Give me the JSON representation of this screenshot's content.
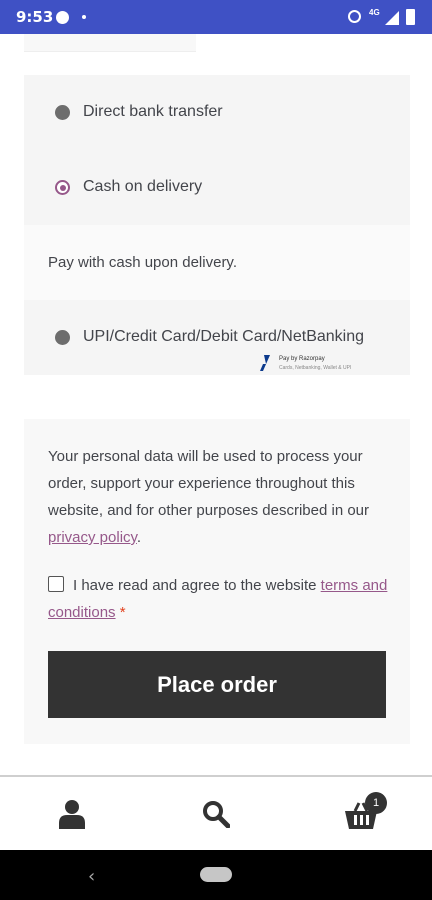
{
  "status_bar": {
    "time": "9:53",
    "network": "4G"
  },
  "payment_methods": [
    {
      "label": "Direct bank transfer",
      "selected": false
    },
    {
      "label": "Cash on delivery",
      "selected": true
    },
    {
      "label": "UPI/Credit Card/Debit Card/NetBanking",
      "selected": false
    }
  ],
  "cod_description": "Pay with cash upon delivery.",
  "razorpay": {
    "title": "Pay by Razorpay",
    "subtitle": "Cards, Netbanking, Wallet & UPI"
  },
  "privacy": {
    "text": "Your personal data will be used to process your order, support your experience throughout this website, and for other purposes described in our ",
    "link": "privacy policy",
    "end": "."
  },
  "terms": {
    "text": "I have read and agree to the website ",
    "link": "terms and conditions",
    "required": "*",
    "checked": false
  },
  "place_order_label": "Place order",
  "bottom_nav": {
    "account_icon": "person-icon",
    "search_icon": "search-icon",
    "cart_icon": "basket-icon",
    "cart_count": "1"
  },
  "colors": {
    "accent": "#96588a",
    "status_bar": "#3f51c5",
    "button": "#333333",
    "required": "#e2401c"
  }
}
